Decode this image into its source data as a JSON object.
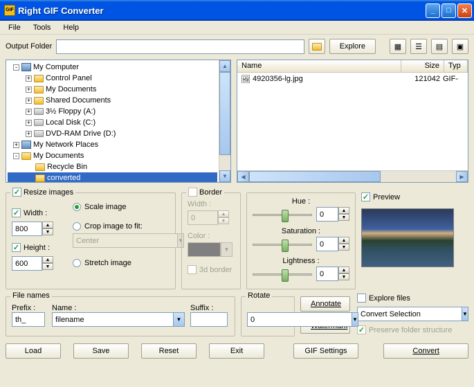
{
  "title": "Right GIF Converter",
  "menu": [
    "File",
    "Tools",
    "Help"
  ],
  "outputFolder": {
    "label": "Output Folder",
    "value": "",
    "explore": "Explore"
  },
  "tree": [
    {
      "indent": 0,
      "exp": "-",
      "icon": "computer",
      "label": "My Computer"
    },
    {
      "indent": 1,
      "exp": "+",
      "icon": "folder",
      "label": "Control Panel"
    },
    {
      "indent": 1,
      "exp": "+",
      "icon": "folder",
      "label": "My Documents"
    },
    {
      "indent": 1,
      "exp": "+",
      "icon": "folder",
      "label": "Shared Documents"
    },
    {
      "indent": 1,
      "exp": "+",
      "icon": "drive",
      "label": "3½ Floppy (A:)"
    },
    {
      "indent": 1,
      "exp": "+",
      "icon": "drive",
      "label": "Local Disk (C:)"
    },
    {
      "indent": 1,
      "exp": "+",
      "icon": "drive",
      "label": "DVD-RAM Drive (D:)"
    },
    {
      "indent": 0,
      "exp": "+",
      "icon": "computer",
      "label": "My Network Places"
    },
    {
      "indent": 0,
      "exp": "-",
      "icon": "folder",
      "label": "My Documents"
    },
    {
      "indent": 1,
      "exp": "",
      "icon": "folder",
      "label": "Recycle Bin"
    },
    {
      "indent": 1,
      "exp": "",
      "icon": "folder",
      "label": "converted",
      "sel": true
    }
  ],
  "fileCols": {
    "name": "Name",
    "size": "Size",
    "type": "Typ"
  },
  "files": [
    {
      "name": "4920356-lg.jpg",
      "size": "121042",
      "type": "GIF-"
    }
  ],
  "resize": {
    "title": "Resize images",
    "checked": true,
    "widthLabel": "Width :",
    "width": "800",
    "widthChecked": true,
    "heightLabel": "Height :",
    "height": "600",
    "heightChecked": true,
    "scale": "Scale image",
    "crop": "Crop image to fit:",
    "cropPos": "Center",
    "stretch": "Stretch image",
    "mode": "scale"
  },
  "border": {
    "title": "Border",
    "checked": false,
    "widthLabel": "Width :",
    "width": "0",
    "colorLabel": "Color :",
    "threeD": "3d border"
  },
  "adjust": {
    "hue": "Hue :",
    "sat": "Saturation :",
    "light": "Lightness :",
    "val": "0"
  },
  "preview": {
    "title": "Preview",
    "checked": true
  },
  "filenames": {
    "title": "File names",
    "prefixLabel": "Prefix :",
    "prefix": "th_",
    "nameLabel": "Name :",
    "name": "filename",
    "suffixLabel": "Suffix :",
    "suffix": ""
  },
  "rotate": {
    "title": "Rotate",
    "value": "0"
  },
  "sidebtns": {
    "annotate": "Annotate",
    "watermark": "Watermark"
  },
  "explore": {
    "title": "Explore files",
    "checked": false,
    "action": "Convert Selection",
    "preserve": "Preserve folder structure"
  },
  "buttons": {
    "load": "Load",
    "save": "Save",
    "reset": "Reset",
    "exit": "Exit",
    "gif": "GIF Settings",
    "convert": "Convert"
  }
}
